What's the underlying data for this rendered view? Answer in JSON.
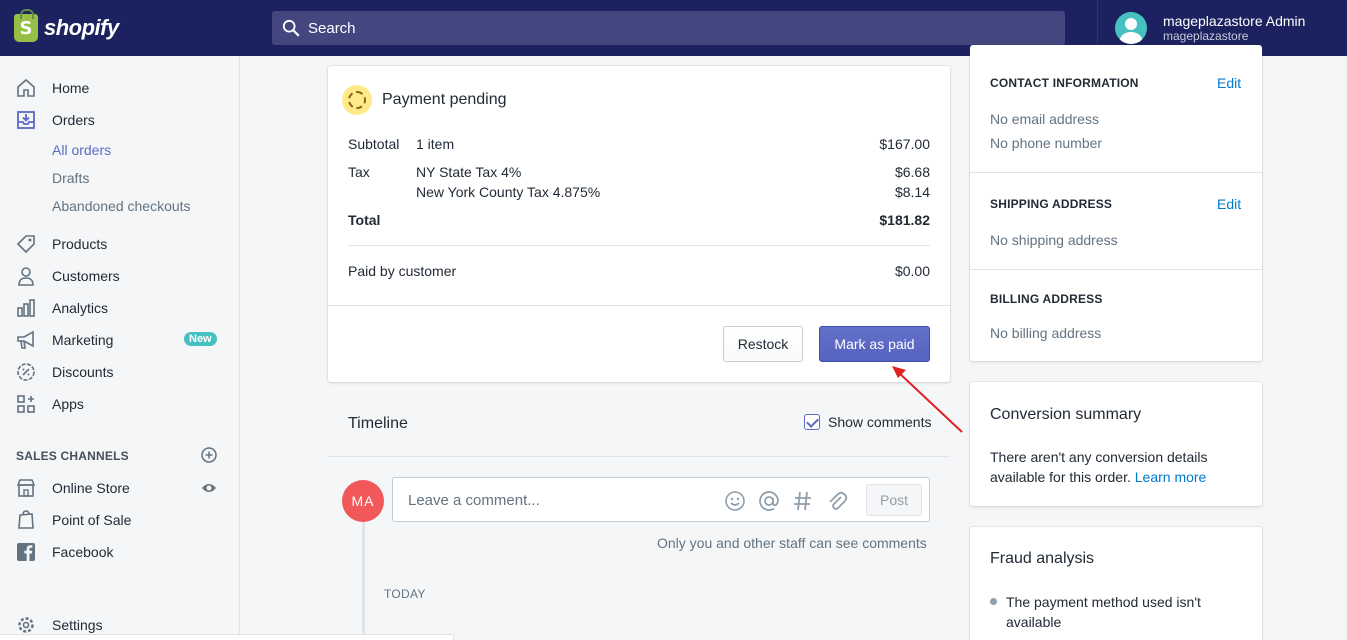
{
  "brand": {
    "logo_letter": "S",
    "name": "shopify"
  },
  "search": {
    "placeholder": "Search"
  },
  "user": {
    "name": "mageplazastore Admin",
    "store": "mageplazastore"
  },
  "sidebar": {
    "items": [
      {
        "label": "Home",
        "icon": "home-icon"
      },
      {
        "label": "Orders",
        "icon": "orders-icon"
      },
      {
        "label": "Products",
        "icon": "tag-icon"
      },
      {
        "label": "Customers",
        "icon": "person-icon"
      },
      {
        "label": "Analytics",
        "icon": "bar-chart-icon"
      },
      {
        "label": "Marketing",
        "icon": "megaphone-icon",
        "badge": "New"
      },
      {
        "label": "Discounts",
        "icon": "discount-icon"
      },
      {
        "label": "Apps",
        "icon": "apps-icon"
      }
    ],
    "order_subitems": [
      "All orders",
      "Drafts",
      "Abandoned checkouts"
    ],
    "sales_channels_title": "SALES CHANNELS",
    "channels": [
      {
        "label": "Online Store",
        "icon": "store-icon"
      },
      {
        "label": "Point of Sale",
        "icon": "pos-icon"
      },
      {
        "label": "Facebook",
        "icon": "facebook-icon"
      }
    ],
    "settings": "Settings"
  },
  "payment": {
    "status": "Payment pending",
    "subtotal_label": "Subtotal",
    "subtotal_desc": "1 item",
    "subtotal_value": "$167.00",
    "tax_label": "Tax",
    "taxes": [
      {
        "name": "NY State Tax 4%",
        "value": "$6.68"
      },
      {
        "name": "New York County Tax 4.875%",
        "value": "$8.14"
      }
    ],
    "total_label": "Total",
    "total_value": "$181.82",
    "paid_label": "Paid by customer",
    "paid_value": "$0.00",
    "restock_button": "Restock",
    "mark_paid_button": "Mark as paid"
  },
  "timeline": {
    "title": "Timeline",
    "show_comments": "Show comments",
    "avatar_initials": "MA",
    "comment_placeholder": "Leave a comment...",
    "post_button": "Post",
    "staff_note": "Only you and other staff can see comments",
    "today": "TODAY"
  },
  "contact": {
    "title": "CONTACT INFORMATION",
    "edit": "Edit",
    "email": "No email address",
    "phone": "No phone number"
  },
  "shipping": {
    "title": "SHIPPING ADDRESS",
    "edit": "Edit",
    "value": "No shipping address"
  },
  "billing": {
    "title": "BILLING ADDRESS",
    "value": "No billing address"
  },
  "conversion": {
    "title": "Conversion summary",
    "text": "There aren't any conversion details available for this order.",
    "link": "Learn more"
  },
  "fraud": {
    "title": "Fraud analysis",
    "item": "The payment method used isn't available"
  },
  "colors": {
    "topbar": "#1c2260",
    "accent": "#5c6ac4",
    "link": "#007ace",
    "annotation_arrow": "#e02020"
  }
}
